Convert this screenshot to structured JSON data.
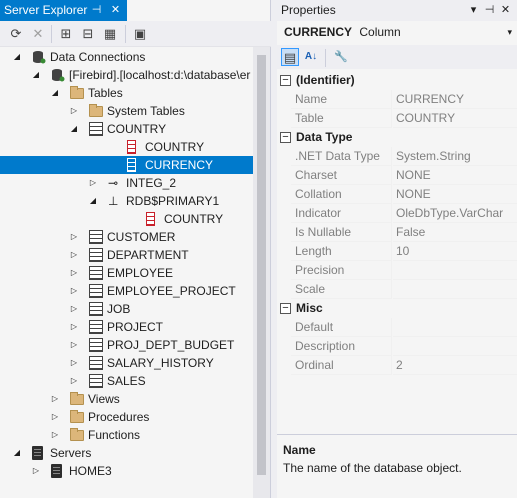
{
  "server_explorer": {
    "title": "Server Explorer",
    "pin_glyph": "⊣",
    "close_glyph": "✕",
    "toolbar": [
      {
        "name": "refresh-icon",
        "glyph": "⟳"
      },
      {
        "name": "stop-icon",
        "glyph": "✕"
      },
      {
        "name": "connect-database-icon",
        "glyph": "⊞"
      },
      {
        "name": "connect-server-icon",
        "glyph": "⊟"
      },
      {
        "name": "sharepoint-icon",
        "glyph": "▦"
      },
      {
        "name": "properties-icon",
        "glyph": "▣"
      }
    ],
    "tree": [
      {
        "label": "Data Connections",
        "level": 0,
        "expander": "◢",
        "icon": "dbconn"
      },
      {
        "label": "[Firebird].[localhost:d:\\database\\er",
        "level": 1,
        "expander": "◢",
        "icon": "db"
      },
      {
        "label": "Tables",
        "level": 2,
        "expander": "◢",
        "icon": "folder"
      },
      {
        "label": "System Tables",
        "level": 3,
        "expander": "▷",
        "icon": "folder"
      },
      {
        "label": "COUNTRY",
        "level": 3,
        "expander": "◢",
        "icon": "table"
      },
      {
        "label": "COUNTRY",
        "level": 5,
        "expander": "",
        "icon": "col"
      },
      {
        "label": "CURRENCY",
        "level": 5,
        "expander": "",
        "icon": "col",
        "selected": true
      },
      {
        "label": "INTEG_2",
        "level": 4,
        "expander": "▷",
        "icon": "key"
      },
      {
        "label": "RDB$PRIMARY1",
        "level": 4,
        "expander": "◢",
        "icon": "index"
      },
      {
        "label": "COUNTRY",
        "level": 6,
        "expander": "",
        "icon": "col"
      },
      {
        "label": "CUSTOMER",
        "level": 3,
        "expander": "▷",
        "icon": "table"
      },
      {
        "label": "DEPARTMENT",
        "level": 3,
        "expander": "▷",
        "icon": "table"
      },
      {
        "label": "EMPLOYEE",
        "level": 3,
        "expander": "▷",
        "icon": "table"
      },
      {
        "label": "EMPLOYEE_PROJECT",
        "level": 3,
        "expander": "▷",
        "icon": "table"
      },
      {
        "label": "JOB",
        "level": 3,
        "expander": "▷",
        "icon": "table"
      },
      {
        "label": "PROJECT",
        "level": 3,
        "expander": "▷",
        "icon": "table"
      },
      {
        "label": "PROJ_DEPT_BUDGET",
        "level": 3,
        "expander": "▷",
        "icon": "table"
      },
      {
        "label": "SALARY_HISTORY",
        "level": 3,
        "expander": "▷",
        "icon": "table"
      },
      {
        "label": "SALES",
        "level": 3,
        "expander": "▷",
        "icon": "table"
      },
      {
        "label": "Views",
        "level": 2,
        "expander": "▷",
        "icon": "folder"
      },
      {
        "label": "Procedures",
        "level": 2,
        "expander": "▷",
        "icon": "folder"
      },
      {
        "label": "Functions",
        "level": 2,
        "expander": "▷",
        "icon": "folder"
      },
      {
        "label": "Servers",
        "level": 0,
        "expander": "◢",
        "icon": "server"
      },
      {
        "label": "HOME3",
        "level": 1,
        "expander": "▷",
        "icon": "server"
      }
    ]
  },
  "properties": {
    "title": "Properties",
    "dropdown_glyph": "▾",
    "pin_glyph": "⊣",
    "close_glyph": "✕",
    "selected_object": {
      "name": "CURRENCY",
      "type": "Column"
    },
    "toolbar": [
      {
        "name": "categorized-icon",
        "glyph": "▤",
        "active": true
      },
      {
        "name": "alphabetical-icon",
        "glyph": "A↓",
        "active": false
      },
      {
        "name": "property-pages-icon",
        "glyph": "🔧",
        "active": false
      }
    ],
    "categories": [
      {
        "name": "(Identifier)",
        "toggle": "−",
        "props": [
          {
            "name": "Name",
            "value": "CURRENCY"
          },
          {
            "name": "Table",
            "value": "COUNTRY"
          }
        ]
      },
      {
        "name": "Data Type",
        "toggle": "−",
        "props": [
          {
            "name": ".NET Data Type",
            "value": "System.String"
          },
          {
            "name": "Charset",
            "value": "NONE"
          },
          {
            "name": "Collation",
            "value": "NONE"
          },
          {
            "name": "Indicator",
            "value": "OleDbType.VarChar"
          },
          {
            "name": "Is Nullable",
            "value": "False"
          },
          {
            "name": "Length",
            "value": "10"
          },
          {
            "name": "Precision",
            "value": ""
          },
          {
            "name": "Scale",
            "value": ""
          }
        ]
      },
      {
        "name": "Misc",
        "toggle": "−",
        "props": [
          {
            "name": "Default",
            "value": ""
          },
          {
            "name": "Description",
            "value": ""
          },
          {
            "name": "Ordinal",
            "value": "2"
          }
        ]
      }
    ],
    "description": {
      "title": "Name",
      "text": "The name of the database object."
    }
  }
}
